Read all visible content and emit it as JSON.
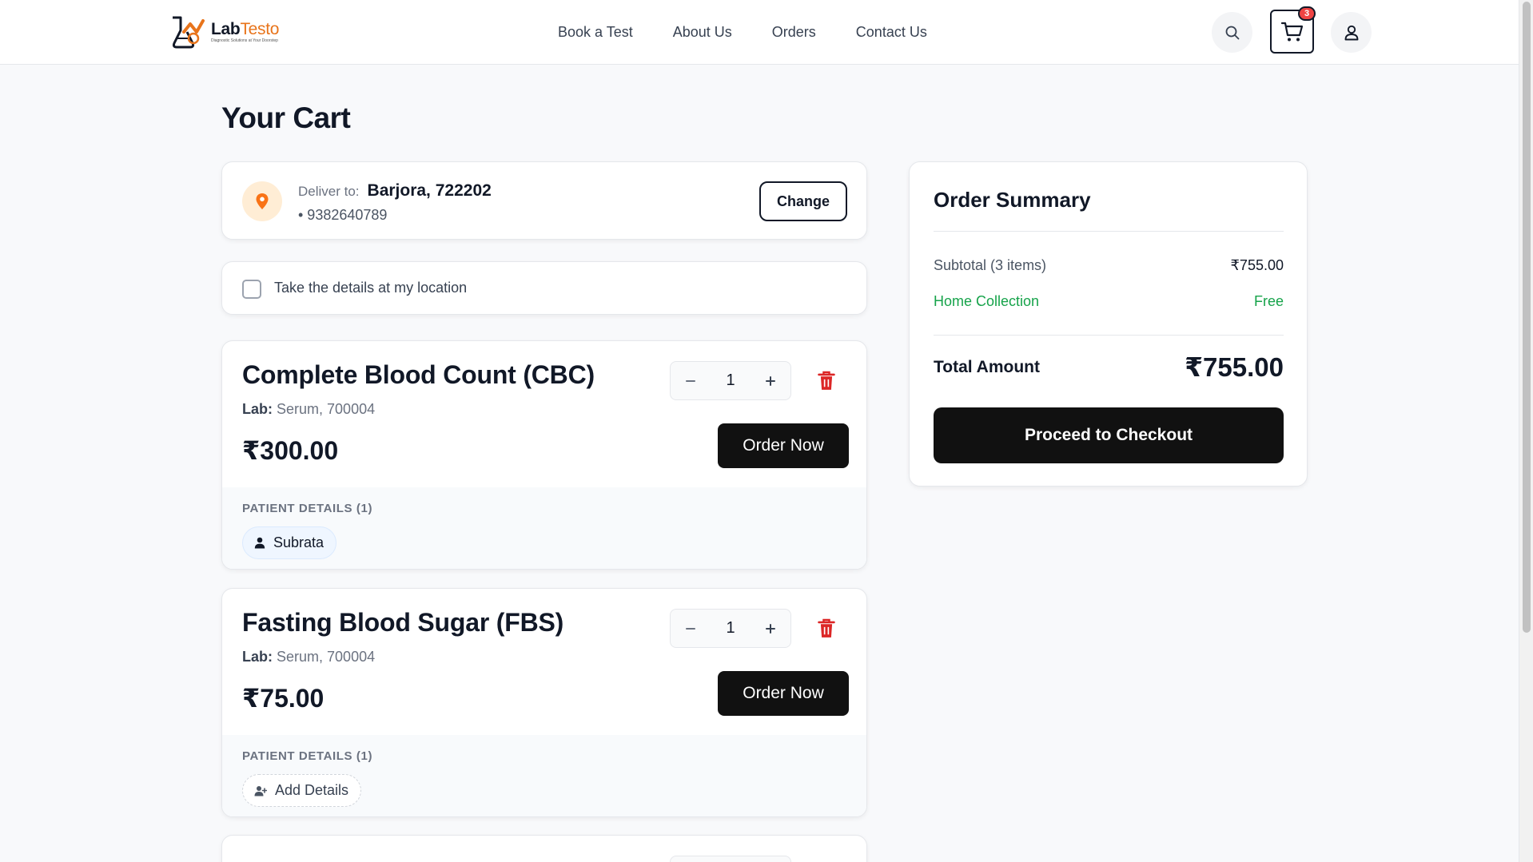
{
  "brand": {
    "name_part1": "Lab",
    "name_part2": "Testo",
    "tagline": "Diagnostic Solutions at Your Doorstep",
    "accent_color": "#e8741b"
  },
  "nav": {
    "items": [
      {
        "label": "Book a Test"
      },
      {
        "label": "About Us"
      },
      {
        "label": "Orders"
      },
      {
        "label": "Contact Us"
      }
    ]
  },
  "header_actions": {
    "search_icon": "search-icon",
    "cart_icon": "cart-icon",
    "cart_count": "3",
    "profile_icon": "user-icon"
  },
  "page": {
    "title": "Your Cart"
  },
  "delivery": {
    "label": "Deliver to:",
    "place": "Barjora, 722202",
    "phone": "• 9382640789",
    "change_label": "Change"
  },
  "location_option": {
    "label": "Take the details at my location",
    "checked": false
  },
  "items": [
    {
      "name": "Complete Blood Count (CBC)",
      "lab_label": "Lab:",
      "lab_value": "Serum, 700004",
      "price": "₹300.00",
      "quantity": "1",
      "order_label": "Order Now",
      "patients_label": "PATIENT DETAILS (1)",
      "patient_chip": "Subrata"
    },
    {
      "name": "Fasting Blood Sugar (FBS)",
      "lab_label": "Lab:",
      "lab_value": "Serum, 700004",
      "price": "₹75.00",
      "quantity": "1",
      "order_label": "Order Now",
      "patients_label": "PATIENT DETAILS (1)",
      "patient_chip": "Add Details"
    }
  ],
  "summary": {
    "title": "Order Summary",
    "subtotal_label": "Subtotal (3 items)",
    "subtotal_value": "₹755.00",
    "collection_label": "Home Collection",
    "collection_value": "Free",
    "total_label": "Total Amount",
    "total_value": "₹755.00",
    "checkout_label": "Proceed to Checkout"
  }
}
